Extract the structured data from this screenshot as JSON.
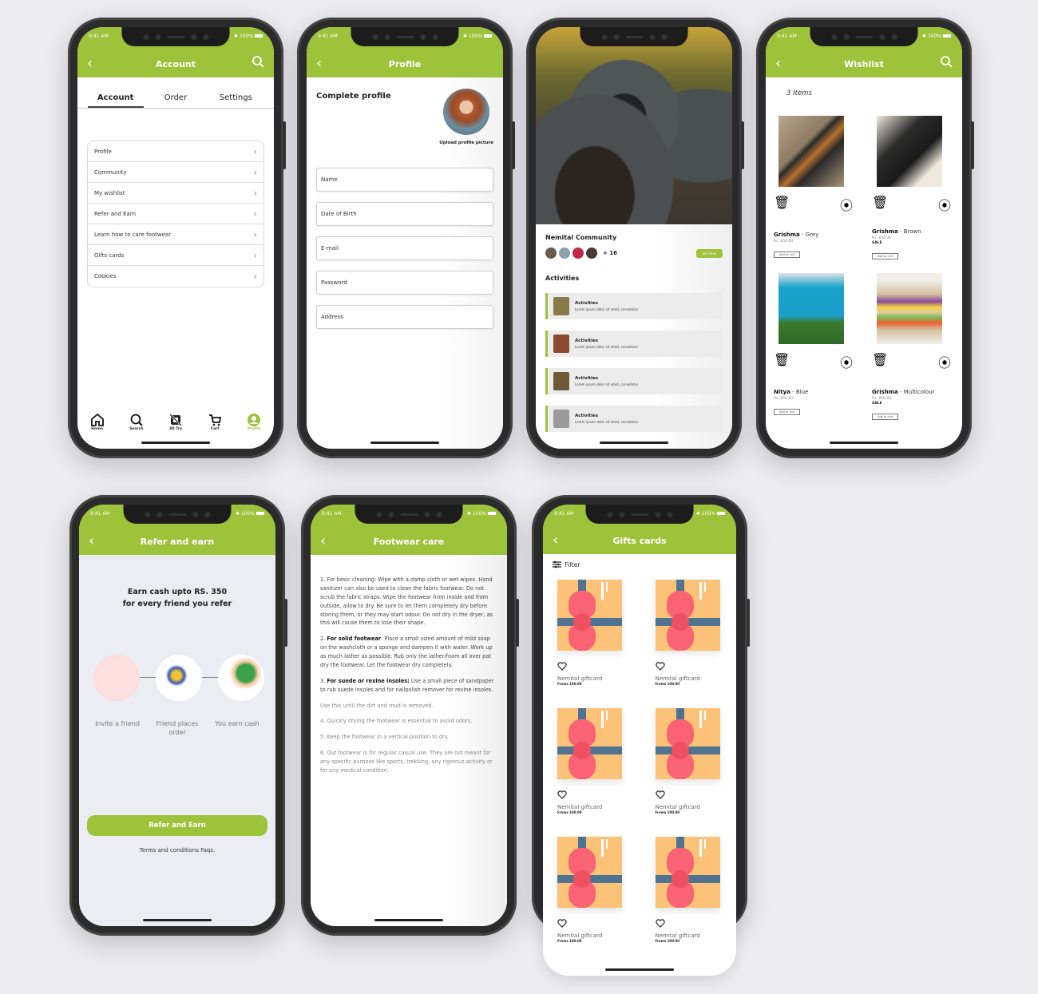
{
  "status_bar": {
    "time": "9:41 AM",
    "battery": "100%"
  },
  "account": {
    "title": "Account",
    "tabs": [
      "Account",
      "Order",
      "Settings"
    ],
    "active_tab": "Account",
    "menu": [
      "Profile",
      "Community",
      "My wishlist",
      "Refer and Earn",
      "Learn how to care footwear",
      "Gifts cards",
      "Cookies"
    ],
    "nav": [
      {
        "label": "Home",
        "icon": "home-icon"
      },
      {
        "label": "Search",
        "icon": "search-icon"
      },
      {
        "label": "3D Try",
        "icon": "3d-try-icon"
      },
      {
        "label": "Cart",
        "icon": "cart-icon"
      },
      {
        "label": "Profile",
        "icon": "profile-icon",
        "active": true
      }
    ]
  },
  "profile": {
    "title": "Profile",
    "heading": "Complete profile",
    "upload_label": "Upload profile picture",
    "fields": [
      "Name",
      "Date of Birth",
      "E-mail",
      "Password",
      "Address"
    ]
  },
  "community": {
    "title": "Nemital Community",
    "member_extra": "+ 16",
    "join_label": "Join Now",
    "activities_title": "Activities",
    "activities": [
      {
        "title": "Activities",
        "desc": "Lorem ipsum dolor sit amet, consetetur"
      },
      {
        "title": "Activities",
        "desc": "Lorem ipsum dolor sit amet, consetetur"
      },
      {
        "title": "Activities",
        "desc": "Lorem ipsum dolor sit amet, consetetur"
      },
      {
        "title": "Activities",
        "desc": "Lorem ipsum dolor sit amet, consetetur"
      }
    ]
  },
  "wishlist": {
    "title": "Wishlist",
    "count": "3 Items",
    "add_to_cart": "Add to cart",
    "items": [
      {
        "name": "Grishma",
        "variant": "Grey",
        "price": "Rs. 850.00",
        "sale": ""
      },
      {
        "name": "Grishma",
        "variant": "Brown",
        "price": "Rs. 850.00",
        "sale": "SALE"
      },
      {
        "name": "Nitya",
        "variant": "Blue",
        "price": "Rs. 850.00",
        "sale": ""
      },
      {
        "name": "Grishma",
        "variant": "Multicolour",
        "price": "Rs. 850.00",
        "sale": "SALE"
      }
    ]
  },
  "refer": {
    "title": "Refer and earn",
    "headline_1": "Earn cash upto RS. 350",
    "headline_2": "for every friend you refer",
    "steps": [
      "Invite a friend",
      "Friend places order",
      "You earn cash"
    ],
    "button": "Refer and Earn",
    "terms": "Terms and conditions Faqs."
  },
  "care": {
    "title": "Footwear care",
    "items": [
      {
        "lead": "",
        "text": "1.  For besic cleaning: Wipe with a damp cloth or wet wipes. Hand sanitizer can also be used to clean the fabric footwear. Do not scrub the fabric straps. Wipe the footwear from inside and from outside, allow to dry. Be sure to let them completely dry before storing them, or they may start odour. Do not dry in the dryer, as this will cause them to lose their shape."
      },
      {
        "num": "2.  ",
        "lead": "For solid footwear",
        "text": ": Place a small sized amount of mild soap on the washcloth or a sponge and dampen it with water. Work up as much lather as possible. Rub only the lather/foam all over pat dry the footwear. Let the footwear dry completely."
      },
      {
        "num": "3.  ",
        "lead": "For suede or rexine insoles:",
        "text": " Use a small  piece of sandpaper to rub suede insoles and for nailpolish remover for rexine insoles."
      },
      {
        "text": "Use this until the dirt and mud is removed."
      },
      {
        "text": "4.  Quickly drying the footwear is essential to avoid odors."
      },
      {
        "text": "5.  Keep the footwear in a vertical position to dry."
      },
      {
        "text": "6.  Out footwear is for regular casual use. They are not meant for any specific purpose like sports, trekking, any rigorous activity or for any medical condition."
      }
    ]
  },
  "gifts": {
    "title": "Gifts cards",
    "filter_label": "Filter",
    "cards": [
      {
        "name": "Nemital giftcard",
        "from": "Froms 100.00"
      },
      {
        "name": "Nemital giftcard",
        "from": "Froms 100.00"
      },
      {
        "name": "Nemital giftcard",
        "from": "Froms 100.00"
      },
      {
        "name": "Nemital giftcard",
        "from": "Froms 100.00"
      },
      {
        "name": "Nemital giftcard",
        "from": "Froms 100.00"
      },
      {
        "name": "Nemital giftcard",
        "from": "Froms 100.00"
      }
    ]
  },
  "colors": {
    "brand_green": "#9dc33b",
    "gift_box": "#fcc378",
    "gift_ribbon": "#4f7390",
    "gift_bow": "#f96374"
  }
}
